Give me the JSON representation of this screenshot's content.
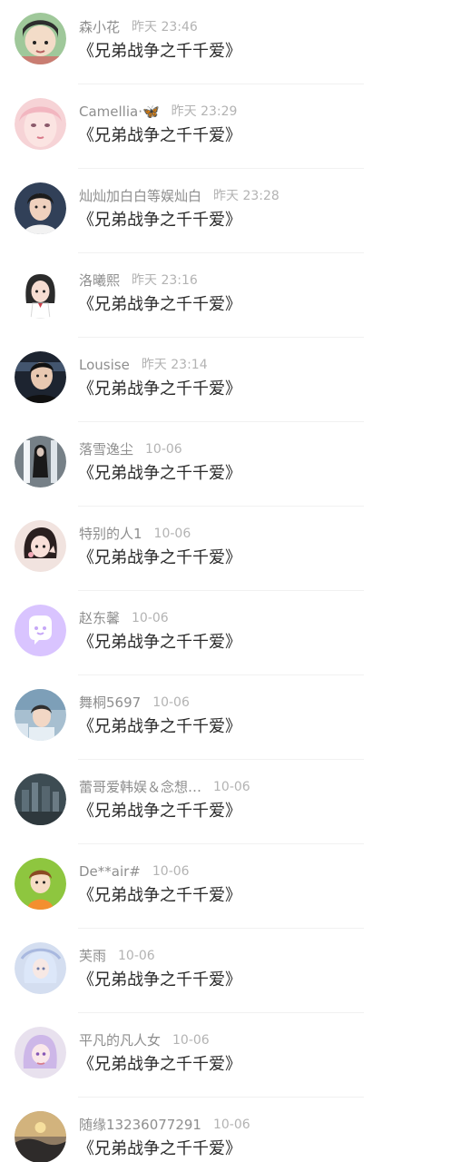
{
  "comments": [
    {
      "name": "森小花",
      "time": "昨天 23:46",
      "content": "《兄弟战争之千千爱》",
      "avatar_color": "#6a9f6a",
      "avatar_icon": "girl-green-avatar"
    },
    {
      "name": "Camellia·🦋",
      "time": "昨天 23:29",
      "content": "《兄弟战争之千千爱》",
      "avatar_color": "#f1c9cd",
      "avatar_icon": "pink-face-avatar"
    },
    {
      "name": "灿灿加白白等娱灿白",
      "time": "昨天 23:28",
      "content": "《兄弟战争之千千爱》",
      "avatar_color": "#2c3a52",
      "avatar_icon": "boy-portrait-avatar"
    },
    {
      "name": "洛曦熙",
      "time": "昨天 23:16",
      "content": "《兄弟战争之千千爱》",
      "avatar_color": "#f5f5f5",
      "avatar_icon": "anime-girl-avatar"
    },
    {
      "name": "Lousise",
      "time": "昨天 23:14",
      "content": "《兄弟战争之千千爱》",
      "avatar_color": "#1f2633",
      "avatar_icon": "man-portrait-avatar"
    },
    {
      "name": "落雪逸尘",
      "time": "10-06",
      "content": "《兄弟战争之千千爱》",
      "avatar_color": "#6f7880",
      "avatar_icon": "corridor-girl-avatar"
    },
    {
      "name": "特别的人1",
      "time": "10-06",
      "content": "《兄弟战争之千千爱》",
      "avatar_color": "#e7d4cf",
      "avatar_icon": "cartoon-girl-avatar"
    },
    {
      "name": "赵东馨",
      "time": "10-06",
      "content": "《兄弟战争之千千爱》",
      "avatar_color": "#d7c2ff",
      "avatar_icon": "chat-bubble-avatar"
    },
    {
      "name": "舞桐5697",
      "time": "10-06",
      "content": "《兄弟战争之千千爱》",
      "avatar_color": "#9fb6c9",
      "avatar_icon": "anime-boy-avatar"
    },
    {
      "name": "蕾哥爱韩娱＆念想…",
      "time": "10-06",
      "content": "《兄弟战争之千千爱》",
      "avatar_color": "#3f4d52",
      "avatar_icon": "city-scene-avatar"
    },
    {
      "name": "De**air#",
      "time": "10-06",
      "content": "《兄弟战争之千千爱》",
      "avatar_color": "#8cc43a",
      "avatar_icon": "green-cartoon-avatar"
    },
    {
      "name": "芙雨",
      "time": "10-06",
      "content": "《兄弟战争之千千爱》",
      "avatar_color": "#c9d7ea",
      "avatar_icon": "blue-illustration-avatar"
    },
    {
      "name": "平凡的凡人女",
      "time": "10-06",
      "content": "《兄弟战争之千千爱》",
      "avatar_color": "#cfc1dc",
      "avatar_icon": "purple-girl-avatar"
    },
    {
      "name": "随缘13236077291",
      "time": "10-06",
      "content": "《兄弟战争之千千爱》",
      "avatar_color": "#7c6d59",
      "avatar_icon": "sunset-avatar"
    }
  ]
}
